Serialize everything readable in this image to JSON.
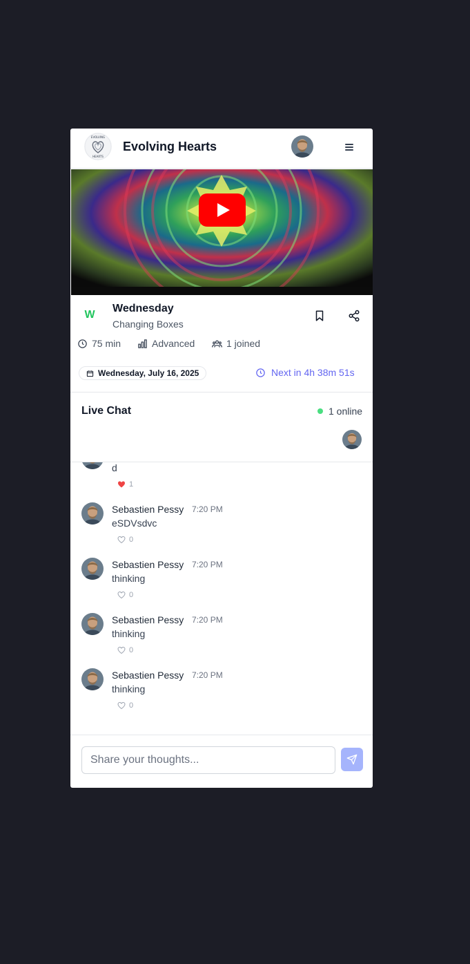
{
  "app": {
    "title": "Evolving Hearts",
    "logo_icon": "evolving-hearts-logo",
    "logo_text": "EVOLVING HEARTS"
  },
  "header": {
    "avatar_icon": "user-avatar",
    "menu_icon": "hamburger-menu-icon"
  },
  "video": {
    "play_icon": "youtube-play-icon",
    "brand_color": "#ff0000"
  },
  "class_info": {
    "icon_letter": "W",
    "day": "Wednesday",
    "name": "Changing Boxes",
    "duration": "75 min",
    "level": "Advanced",
    "joined": "1 joined",
    "date": "Wednesday, July 16, 2025",
    "next_session": "Next in 4h 38m 51s"
  },
  "chat": {
    "title": "Live Chat",
    "online_text": "1 online",
    "input_placeholder": "Share your thoughts...",
    "input_value": "",
    "messages": [
      {
        "author": "",
        "time": "",
        "text": "d",
        "likes": "1",
        "liked": true
      },
      {
        "author": "Sebastien Pessy",
        "time": "7:20 PM",
        "text": "eSDVsdvc",
        "likes": "0",
        "liked": false
      },
      {
        "author": "Sebastien Pessy",
        "time": "7:20 PM",
        "text": "thinking",
        "likes": "0",
        "liked": false
      },
      {
        "author": "Sebastien Pessy",
        "time": "7:20 PM",
        "text": "thinking",
        "likes": "0",
        "liked": false
      },
      {
        "author": "Sebastien Pessy",
        "time": "7:20 PM",
        "text": "thinking",
        "likes": "0",
        "liked": false
      }
    ]
  },
  "colors": {
    "accent": "#6366f1",
    "send_button": "#a5b4fc",
    "online": "#4ade80",
    "like_active": "#ef4444",
    "class_letter": "#22c55e",
    "background": "#1c1d26"
  }
}
